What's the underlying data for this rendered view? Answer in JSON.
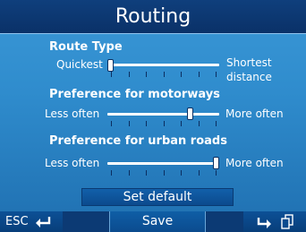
{
  "header": {
    "title": "Routing"
  },
  "sections": [
    {
      "title": "Route Type",
      "left_label": "Quickest",
      "right_label_line1": "Shortest",
      "right_label_line2": "distance",
      "value": 0.0
    },
    {
      "title": "Preference for motorways",
      "left_label": "Less often",
      "right_label": "More often",
      "value": 0.75
    },
    {
      "title": "Preference for urban roads",
      "left_label": "Less often",
      "right_label": "More often",
      "value": 1.0
    }
  ],
  "buttons": {
    "set_default": "Set default",
    "save": "Save",
    "esc": "ESC"
  },
  "icons": {
    "back": "return-arrow-icon",
    "redo": "redo-arrow-icon",
    "copy": "copy-pages-icon"
  },
  "colors": {
    "background": "#2f8ccd",
    "title_bar": "#0f3f7c",
    "button": "#0b4a8d",
    "text": "#ffffff"
  }
}
